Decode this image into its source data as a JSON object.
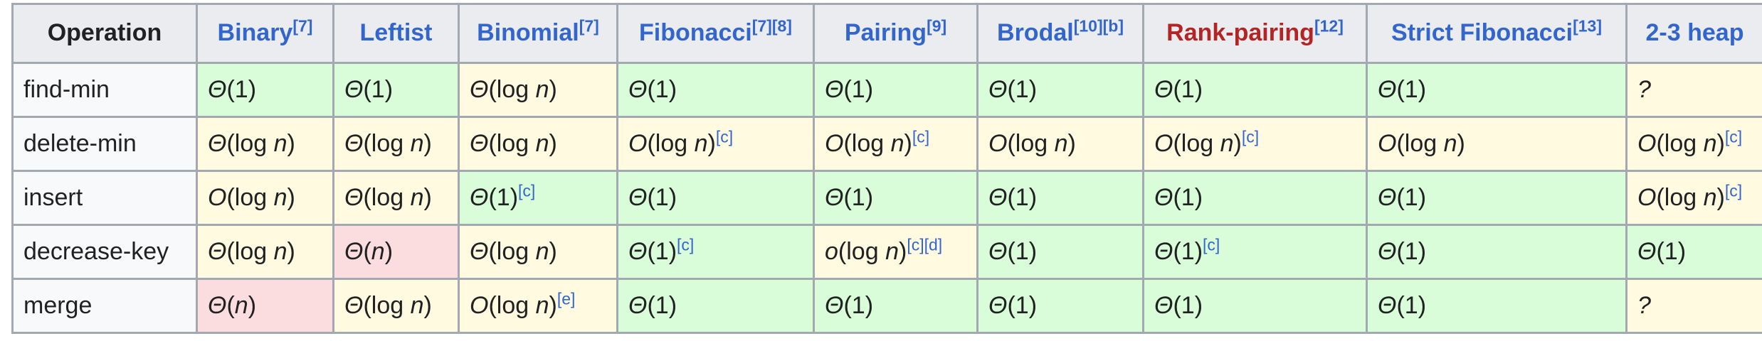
{
  "table": {
    "corner_header": "Operation",
    "columns": [
      {
        "name": "Binary",
        "ref": "[7]",
        "color": "#3366cc"
      },
      {
        "name": "Leftist",
        "ref": "",
        "color": "#3366cc"
      },
      {
        "name": "Binomial",
        "ref": "[7]",
        "color": "#3366cc"
      },
      {
        "name": "Fibonacci",
        "ref": "[7][8]",
        "color": "#3366cc"
      },
      {
        "name": "Pairing",
        "ref": "[9]",
        "color": "#3366cc"
      },
      {
        "name": "Brodal",
        "ref": "[10][b]",
        "color": "#3366cc"
      },
      {
        "name": "Rank-pairing",
        "ref": "[12]",
        "color": "#b32424"
      },
      {
        "name": "Strict Fibonacci",
        "ref": "[13]",
        "color": "#3366cc"
      },
      {
        "name": "2-3 heap",
        "ref": "",
        "color": "#3366cc"
      }
    ],
    "rows": [
      {
        "operation": "find-min",
        "cells": [
          {
            "sym": "Θ",
            "arg": "1",
            "ref": "",
            "tone": "good"
          },
          {
            "sym": "Θ",
            "arg": "1",
            "ref": "",
            "tone": "good"
          },
          {
            "sym": "Θ",
            "arg": "log n",
            "ref": "",
            "tone": "fair"
          },
          {
            "sym": "Θ",
            "arg": "1",
            "ref": "",
            "tone": "good"
          },
          {
            "sym": "Θ",
            "arg": "1",
            "ref": "",
            "tone": "good"
          },
          {
            "sym": "Θ",
            "arg": "1",
            "ref": "",
            "tone": "good"
          },
          {
            "sym": "Θ",
            "arg": "1",
            "ref": "",
            "tone": "good"
          },
          {
            "sym": "Θ",
            "arg": "1",
            "ref": "",
            "tone": "good"
          },
          {
            "sym": "?",
            "arg": "",
            "ref": "",
            "tone": "fair"
          }
        ]
      },
      {
        "operation": "delete-min",
        "cells": [
          {
            "sym": "Θ",
            "arg": "log n",
            "ref": "",
            "tone": "fair"
          },
          {
            "sym": "Θ",
            "arg": "log n",
            "ref": "",
            "tone": "fair"
          },
          {
            "sym": "Θ",
            "arg": "log n",
            "ref": "",
            "tone": "fair"
          },
          {
            "sym": "O",
            "arg": "log n",
            "ref": "[c]",
            "tone": "fair"
          },
          {
            "sym": "O",
            "arg": "log n",
            "ref": "[c]",
            "tone": "fair"
          },
          {
            "sym": "O",
            "arg": "log n",
            "ref": "",
            "tone": "fair"
          },
          {
            "sym": "O",
            "arg": "log n",
            "ref": "[c]",
            "tone": "fair"
          },
          {
            "sym": "O",
            "arg": "log n",
            "ref": "",
            "tone": "fair"
          },
          {
            "sym": "O",
            "arg": "log n",
            "ref": "[c]",
            "tone": "fair"
          }
        ]
      },
      {
        "operation": "insert",
        "cells": [
          {
            "sym": "O",
            "arg": "log n",
            "ref": "",
            "tone": "fair"
          },
          {
            "sym": "Θ",
            "arg": "log n",
            "ref": "",
            "tone": "fair"
          },
          {
            "sym": "Θ",
            "arg": "1",
            "ref": "[c]",
            "tone": "good"
          },
          {
            "sym": "Θ",
            "arg": "1",
            "ref": "",
            "tone": "good"
          },
          {
            "sym": "Θ",
            "arg": "1",
            "ref": "",
            "tone": "good"
          },
          {
            "sym": "Θ",
            "arg": "1",
            "ref": "",
            "tone": "good"
          },
          {
            "sym": "Θ",
            "arg": "1",
            "ref": "",
            "tone": "good"
          },
          {
            "sym": "Θ",
            "arg": "1",
            "ref": "",
            "tone": "good"
          },
          {
            "sym": "O",
            "arg": "log n",
            "ref": "[c]",
            "tone": "fair"
          }
        ]
      },
      {
        "operation": "decrease-key",
        "cells": [
          {
            "sym": "Θ",
            "arg": "log n",
            "ref": "",
            "tone": "fair"
          },
          {
            "sym": "Θ",
            "arg": "n",
            "ref": "",
            "tone": "bad"
          },
          {
            "sym": "Θ",
            "arg": "log n",
            "ref": "",
            "tone": "fair"
          },
          {
            "sym": "Θ",
            "arg": "1",
            "ref": "[c]",
            "tone": "good"
          },
          {
            "sym": "o",
            "arg": "log n",
            "ref": "[c][d]",
            "tone": "fair"
          },
          {
            "sym": "Θ",
            "arg": "1",
            "ref": "",
            "tone": "good"
          },
          {
            "sym": "Θ",
            "arg": "1",
            "ref": "[c]",
            "tone": "good"
          },
          {
            "sym": "Θ",
            "arg": "1",
            "ref": "",
            "tone": "good"
          },
          {
            "sym": "Θ",
            "arg": "1",
            "ref": "",
            "tone": "good"
          }
        ]
      },
      {
        "operation": "merge",
        "cells": [
          {
            "sym": "Θ",
            "arg": "n",
            "ref": "",
            "tone": "bad"
          },
          {
            "sym": "Θ",
            "arg": "log n",
            "ref": "",
            "tone": "fair"
          },
          {
            "sym": "O",
            "arg": "log n",
            "ref": "[e]",
            "tone": "fair"
          },
          {
            "sym": "Θ",
            "arg": "1",
            "ref": "",
            "tone": "good"
          },
          {
            "sym": "Θ",
            "arg": "1",
            "ref": "",
            "tone": "good"
          },
          {
            "sym": "Θ",
            "arg": "1",
            "ref": "",
            "tone": "good"
          },
          {
            "sym": "Θ",
            "arg": "1",
            "ref": "",
            "tone": "good"
          },
          {
            "sym": "Θ",
            "arg": "1",
            "ref": "",
            "tone": "good"
          },
          {
            "sym": "?",
            "arg": "",
            "ref": "",
            "tone": "fair"
          }
        ]
      }
    ]
  },
  "colors": {
    "header_bg": "#eaecf0",
    "row_header_bg": "#f8f9fa",
    "good": "#d9fcd9",
    "fair": "#fffae0",
    "bad": "#fbdde0",
    "link": "#3366cc",
    "redlink": "#b32424",
    "border": "#a2a9b1"
  }
}
